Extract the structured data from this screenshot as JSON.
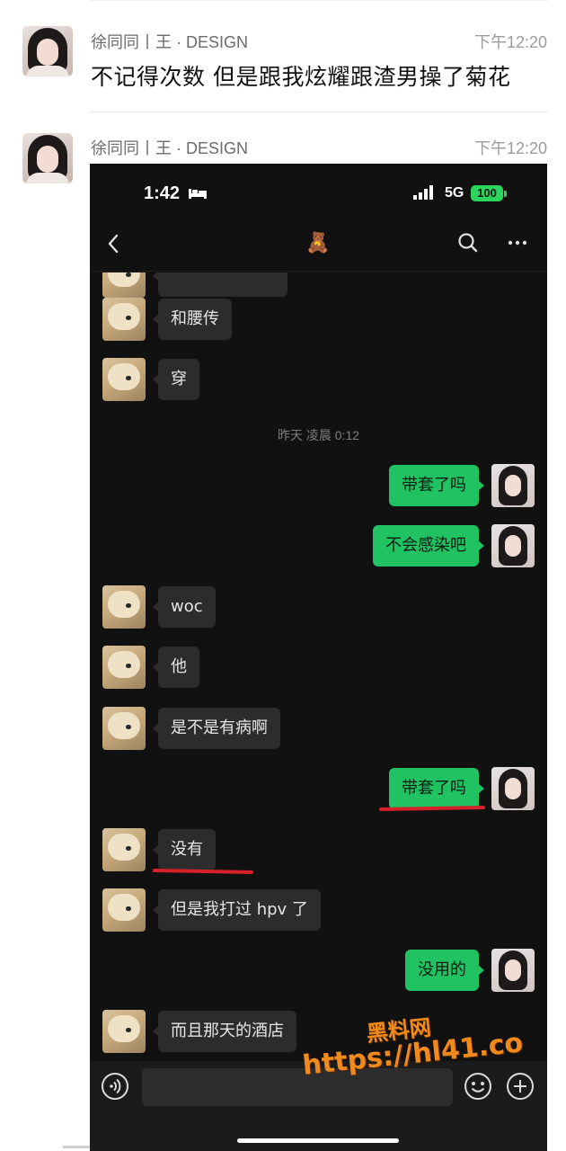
{
  "feed": [
    {
      "author": "徐同同丨王 · DESIGN",
      "time": "下午12:20",
      "text": "不记得次数 但是跟我炫耀跟渣男操了菊花"
    },
    {
      "author": "徐同同丨王 · DESIGN",
      "time": "下午12:20"
    }
  ],
  "chat": {
    "status_time": "1:42",
    "network": "5G",
    "battery": "100",
    "title_emoji": "🧸",
    "timestamp": "昨天 凌晨 0:12",
    "messages": [
      {
        "side": "in",
        "text": "和腰传"
      },
      {
        "side": "in",
        "text": "穿"
      },
      {
        "side": "out",
        "text": "带套了吗"
      },
      {
        "side": "out",
        "text": "不会感染吧"
      },
      {
        "side": "in",
        "text": "woc"
      },
      {
        "side": "in",
        "text": "他"
      },
      {
        "side": "in",
        "text": "是不是有病啊"
      },
      {
        "side": "out",
        "text": "带套了吗"
      },
      {
        "side": "in",
        "text": "没有"
      },
      {
        "side": "in",
        "text": "但是我打过 hpv 了"
      },
      {
        "side": "out",
        "text": "没用的"
      },
      {
        "side": "in",
        "text": "而且那天的酒店"
      }
    ]
  },
  "watermark": {
    "name": "黑料网",
    "url": "https://hl41.co",
    "color": "#f08a1d"
  },
  "colors": {
    "bubble_out": "#20c262",
    "bubble_in": "#2c2c2c",
    "annotation": "#d6202a"
  }
}
